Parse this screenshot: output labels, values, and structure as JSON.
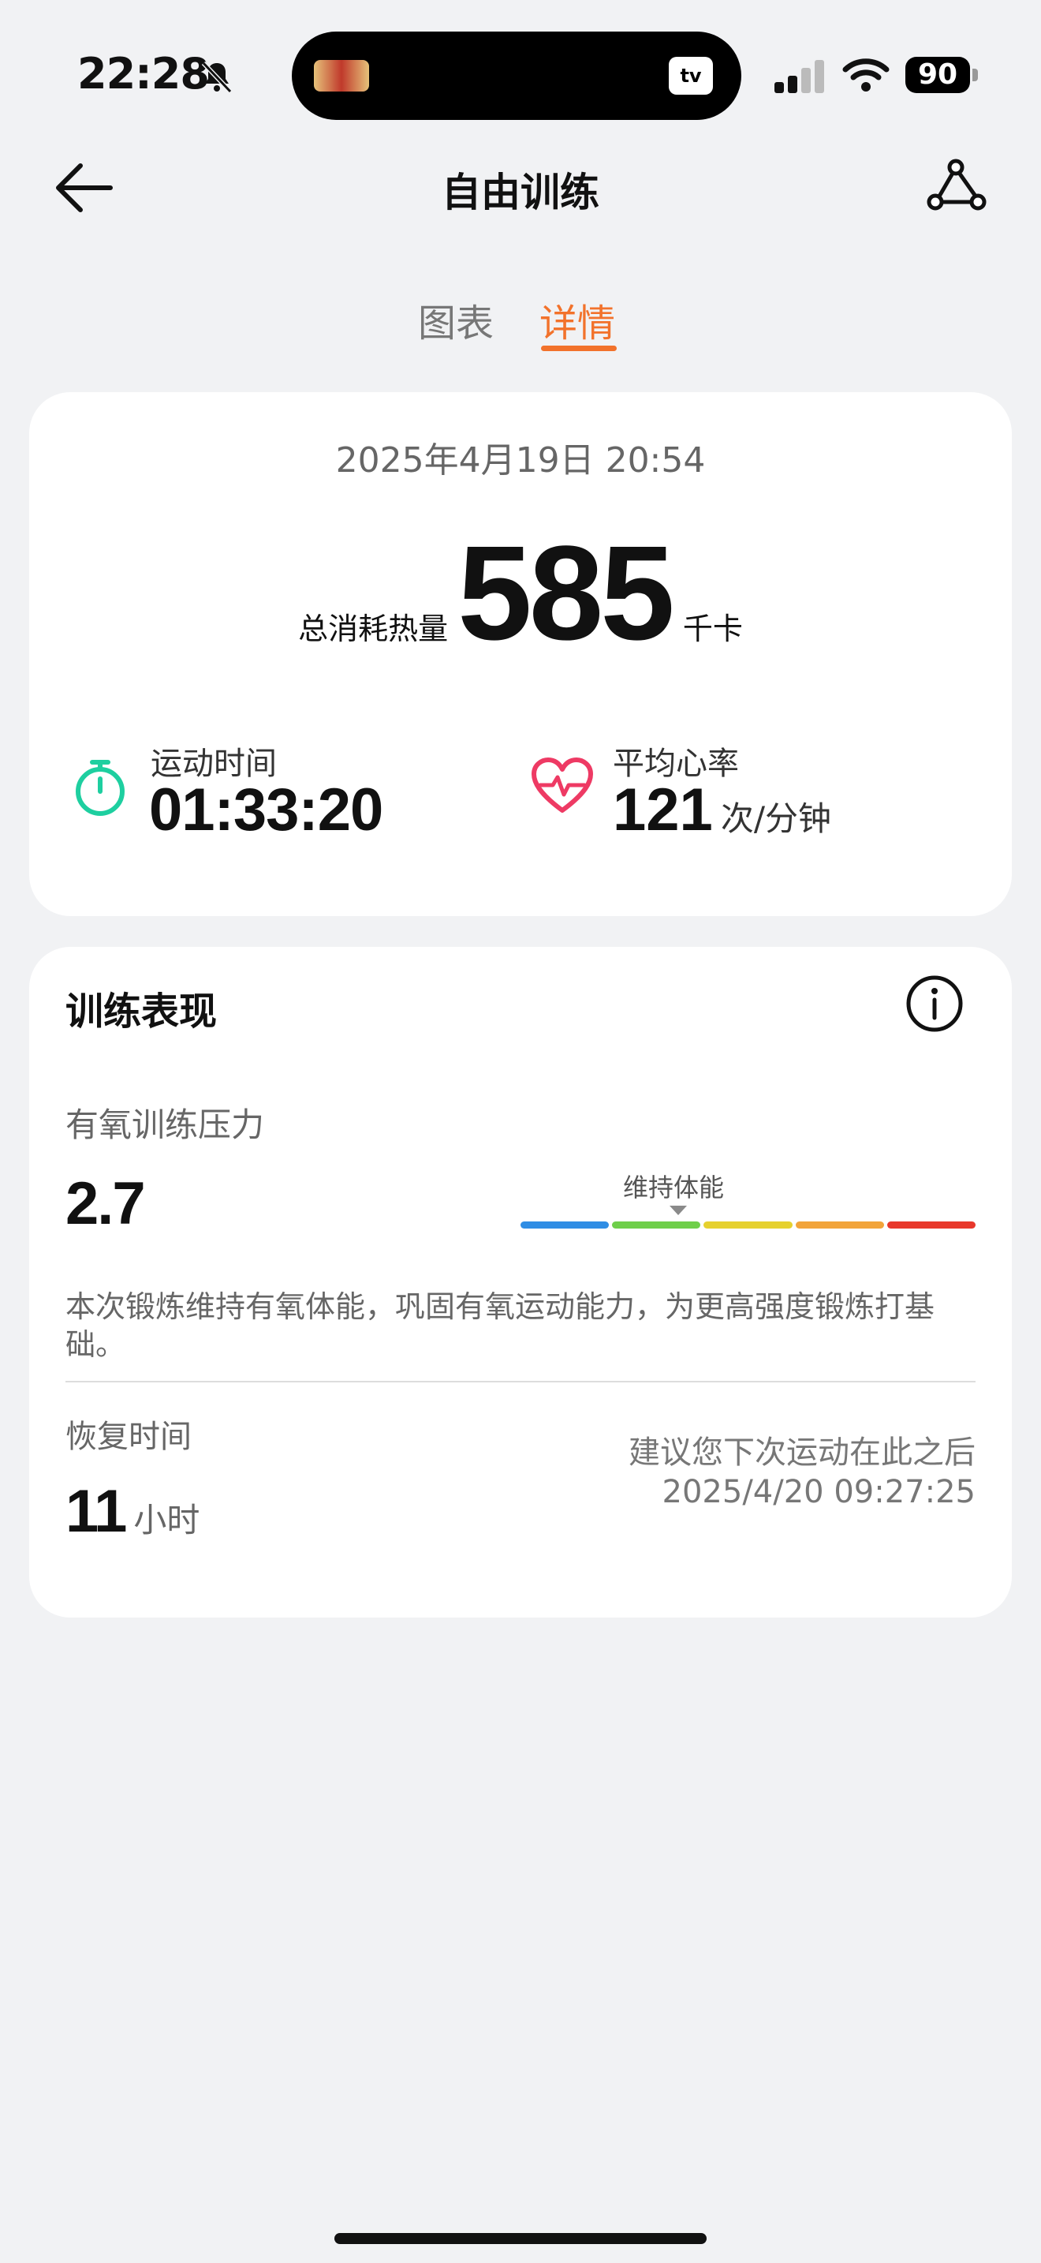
{
  "status_bar": {
    "time": "22:28",
    "battery": "90",
    "island_app_label": "tv"
  },
  "header": {
    "title": "自由训练"
  },
  "tabs": [
    {
      "label": "图表",
      "active": false
    },
    {
      "label": "详情",
      "active": true
    }
  ],
  "summary": {
    "date": "2025年4月19日 20:54",
    "calories_label": "总消耗热量",
    "calories_value": "585",
    "calories_unit": "千卡",
    "duration_label": "运动时间",
    "duration_value": "01:33:20",
    "heart_rate_label": "平均心率",
    "heart_rate_value": "121",
    "heart_rate_unit": "次/分钟"
  },
  "performance": {
    "title": "训练表现",
    "aerobic_label": "有氧训练压力",
    "aerobic_value": "2.7",
    "scale_level": "维持体能",
    "scale_colors": [
      "#2f8de4",
      "#6fcf4a",
      "#e6d12e",
      "#f2a43a",
      "#e8382b"
    ],
    "aerobic_description": "本次锻炼维持有氧体能，巩固有氧运动能力，为更高强度锻炼打基础。",
    "recovery_label": "恢复时间",
    "recovery_value": "11",
    "recovery_unit": "小时",
    "recovery_advice": "建议您下次运动在此之后",
    "recovery_until": "2025/4/20 09:27:25"
  },
  "colors": {
    "accent": "#f2722b",
    "timer": "#1ecfa0",
    "heart": "#ee3a64"
  }
}
